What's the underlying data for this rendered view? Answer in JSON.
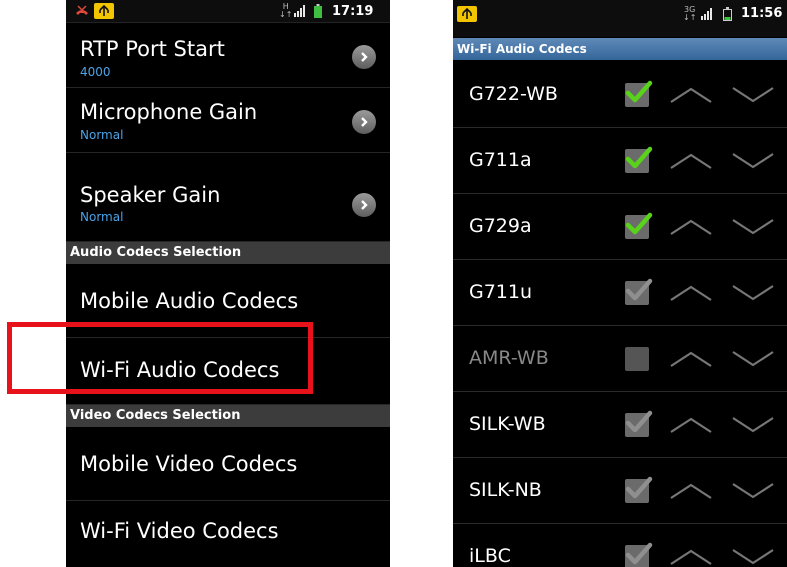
{
  "left_phone": {
    "status_bar": {
      "time": "17:19",
      "network": "H"
    },
    "settings": [
      {
        "title": "RTP Port Start",
        "summary": "4000"
      },
      {
        "title": "Microphone Gain",
        "summary": "Normal"
      },
      {
        "title": "Speaker Gain",
        "summary": "Normal"
      }
    ],
    "sections": [
      {
        "header": "Audio Codecs Selection",
        "items": [
          "Mobile Audio Codecs",
          "Wi-Fi Audio Codecs"
        ]
      },
      {
        "header": "Video Codecs Selection",
        "items": [
          "Mobile Video Codecs",
          "Wi-Fi Video Codecs"
        ]
      }
    ],
    "highlighted_item": "Wi-Fi Audio Codecs",
    "highlight_color": "#e8121a"
  },
  "right_phone": {
    "status_bar": {
      "time": "11:56",
      "network": "3G"
    },
    "title": "Wi-Fi Audio Codecs",
    "codecs": [
      {
        "name": "G722-WB",
        "checked": true
      },
      {
        "name": "G711a",
        "checked": true
      },
      {
        "name": "G729a",
        "checked": true
      },
      {
        "name": "G711u",
        "checked": true
      },
      {
        "name": "AMR-WB",
        "checked": false
      },
      {
        "name": "SILK-WB",
        "checked": true
      },
      {
        "name": "SILK-NB",
        "checked": true
      },
      {
        "name": "iLBC",
        "checked": true
      }
    ],
    "checkmark_color": "#59d21a"
  }
}
